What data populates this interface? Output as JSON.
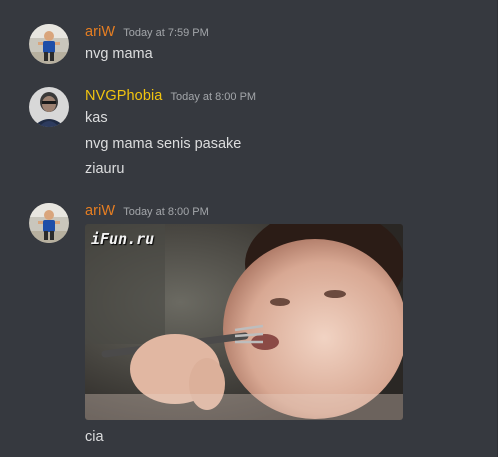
{
  "messages": [
    {
      "username": "ariW",
      "username_color": "#e67e22",
      "timestamp": "Today at 7:59 PM",
      "lines": [
        "nvg mama"
      ]
    },
    {
      "username": "NVGPhobia",
      "username_color": "#f1c40f",
      "timestamp": "Today at 8:00 PM",
      "lines": [
        "kas",
        "nvg mama senis pasake",
        "ziauru"
      ]
    },
    {
      "username": "ariW",
      "username_color": "#e67e22",
      "timestamp": "Today at 8:00 PM",
      "gif": {
        "watermark": "iFun.ru"
      },
      "lines": [
        "cia"
      ]
    }
  ]
}
